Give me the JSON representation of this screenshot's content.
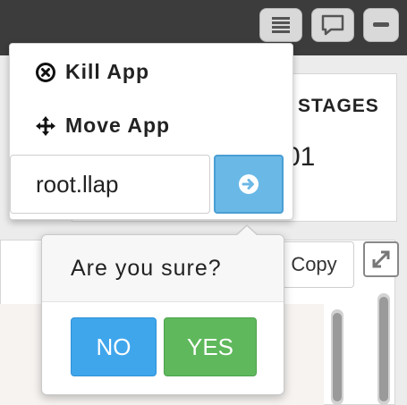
{
  "toolbar": {
    "buttons": [
      {
        "icon": "menu-icon"
      },
      {
        "icon": "chat-icon"
      },
      {
        "icon": "minimize-icon"
      }
    ]
  },
  "stages": {
    "label": "STAGES",
    "value": "01"
  },
  "actions_menu": {
    "kill_app": {
      "label": "Kill App",
      "icon": "circle-x-icon"
    },
    "move_app": {
      "label": "Move App",
      "icon": "move-arrows-icon"
    },
    "queue_input_value": "root.llap",
    "go_button_icon": "arrow-right-circle-icon"
  },
  "copy_button": {
    "label": "Copy"
  },
  "expand_button": {
    "icon": "expand-icon"
  },
  "confirm_popover": {
    "question": "Are you sure?",
    "no_label": "NO",
    "yes_label": "YES"
  },
  "colors": {
    "topbar": "#3c3c3c",
    "go_button": "#6ab8e6",
    "no_button": "#3fa6ec",
    "yes_button": "#5fb85c"
  }
}
